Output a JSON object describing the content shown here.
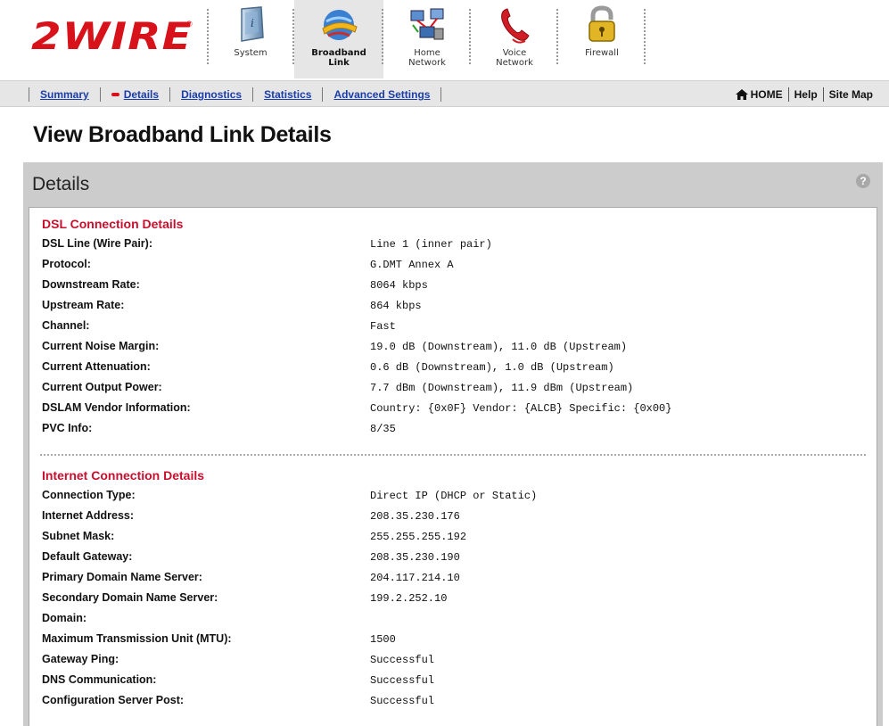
{
  "logo": {
    "text": "2WIRE",
    "reg": "®"
  },
  "nav_tabs": [
    {
      "label": "System",
      "icon": "system-icon",
      "active": false
    },
    {
      "label": "Broadband\nLink",
      "icon": "broadband-globe-icon",
      "active": true
    },
    {
      "label": "Home\nNetwork",
      "icon": "home-network-icon",
      "active": false
    },
    {
      "label": "Voice\nNetwork",
      "icon": "voice-phone-icon",
      "active": false
    },
    {
      "label": "Firewall",
      "icon": "padlock-icon",
      "active": false
    }
  ],
  "subnav": {
    "items": [
      "Summary",
      "Details",
      "Diagnostics",
      "Statistics",
      "Advanced Settings"
    ],
    "active": "Details",
    "right": {
      "home": "HOME",
      "help": "Help",
      "sitemap": "Site Map"
    }
  },
  "page_title": "View Broadband Link Details",
  "panel": {
    "title": "Details",
    "help_glyph": "?",
    "dsl": {
      "heading": "DSL Connection Details",
      "rows": [
        {
          "label": "DSL Line (Wire Pair):",
          "value": "Line 1 (inner pair)"
        },
        {
          "label": "Protocol:",
          "value": "G.DMT Annex A"
        },
        {
          "label": "Downstream Rate:",
          "value": "8064 kbps"
        },
        {
          "label": "Upstream Rate:",
          "value": "864 kbps"
        },
        {
          "label": "Channel:",
          "value": "Fast"
        },
        {
          "label": "Current Noise Margin:",
          "value": "19.0 dB (Downstream), 11.0 dB (Upstream)"
        },
        {
          "label": "Current Attenuation:",
          "value": "0.6 dB (Downstream), 1.0 dB (Upstream)"
        },
        {
          "label": "Current Output Power:",
          "value": "7.7 dBm (Downstream), 11.9 dBm (Upstream)"
        },
        {
          "label": "DSLAM Vendor Information:",
          "value": "Country: {0x0F} Vendor: {ALCB} Specific: {0x00}"
        },
        {
          "label": "PVC Info:",
          "value": "8/35"
        }
      ]
    },
    "internet": {
      "heading": "Internet Connection Details",
      "rows": [
        {
          "label": "Connection Type:",
          "value": "Direct IP (DHCP or Static)"
        },
        {
          "label": "Internet Address:",
          "value": "208.35.230.176"
        },
        {
          "label": "Subnet Mask:",
          "value": "255.255.255.192"
        },
        {
          "label": "Default Gateway:",
          "value": "208.35.230.190"
        },
        {
          "label": "Primary Domain Name Server:",
          "value": "204.117.214.10"
        },
        {
          "label": "Secondary Domain Name Server:",
          "value": "199.2.252.10"
        },
        {
          "label": "Domain:",
          "value": ""
        },
        {
          "label": "Maximum Transmission Unit (MTU):",
          "value": "1500"
        },
        {
          "label": "Gateway Ping:",
          "value": "Successful"
        },
        {
          "label": "DNS Communication:",
          "value": "Successful"
        },
        {
          "label": "Configuration Server Post:",
          "value": "Successful"
        }
      ]
    }
  }
}
